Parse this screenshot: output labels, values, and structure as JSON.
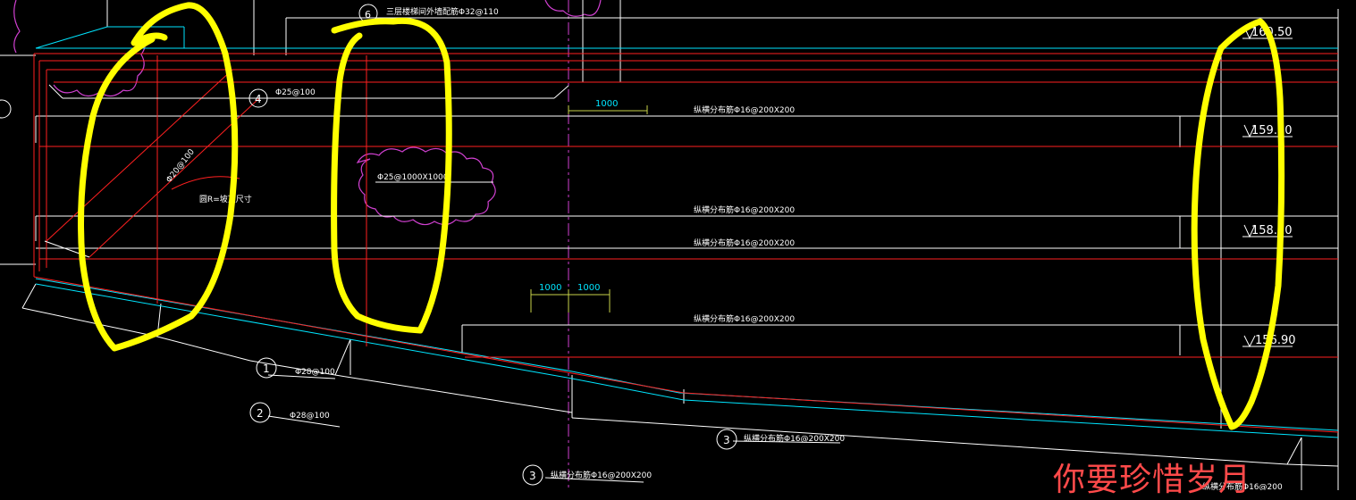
{
  "annotations": {
    "top_label": "三层楼梯间外墙配筋Φ32@110",
    "top_marker": "6",
    "marker4": "4",
    "rebar4": "Φ25@100",
    "rebar_diag": "Φ20@100",
    "arc_note": "圆R=坡顶尺寸",
    "rebar_mid": "Φ25@1000X1000",
    "dim_1000_top": "1000",
    "dist1": "纵横分布筋Φ16@200X200",
    "dist2": "纵横分布筋Φ16@200X200",
    "dist3": "纵横分布筋Φ16@200X200",
    "dist4": "纵横分布筋Φ16@200X200",
    "dim_1000_a": "1000",
    "dim_1000_b": "1000",
    "marker1": "1",
    "rebar1": "Φ28@100",
    "marker2": "2",
    "rebar2": "Φ28@100",
    "marker3a": "3",
    "rebar3a": "纵横分布筋Φ16@200X200",
    "marker3b": "3",
    "rebar3b": "纵横分布筋Φ16@200X200",
    "elev1": "160.50",
    "elev2": "159.30",
    "elev3": "158.10",
    "elev4": "156.90",
    "corner_partial": "纵横分布筋Φ16@200",
    "watermark": "你要珍惜岁月"
  },
  "colors": {
    "background": "#000000",
    "line_white": "#ffffff",
    "line_red": "#ff2020",
    "line_cyan": "#00e5ff",
    "line_magenta": "#d040d0",
    "dim_yellow_green": "#c8d24a",
    "highlight_yellow": "#ffff00",
    "watermark_red": "#ff4a4a"
  }
}
